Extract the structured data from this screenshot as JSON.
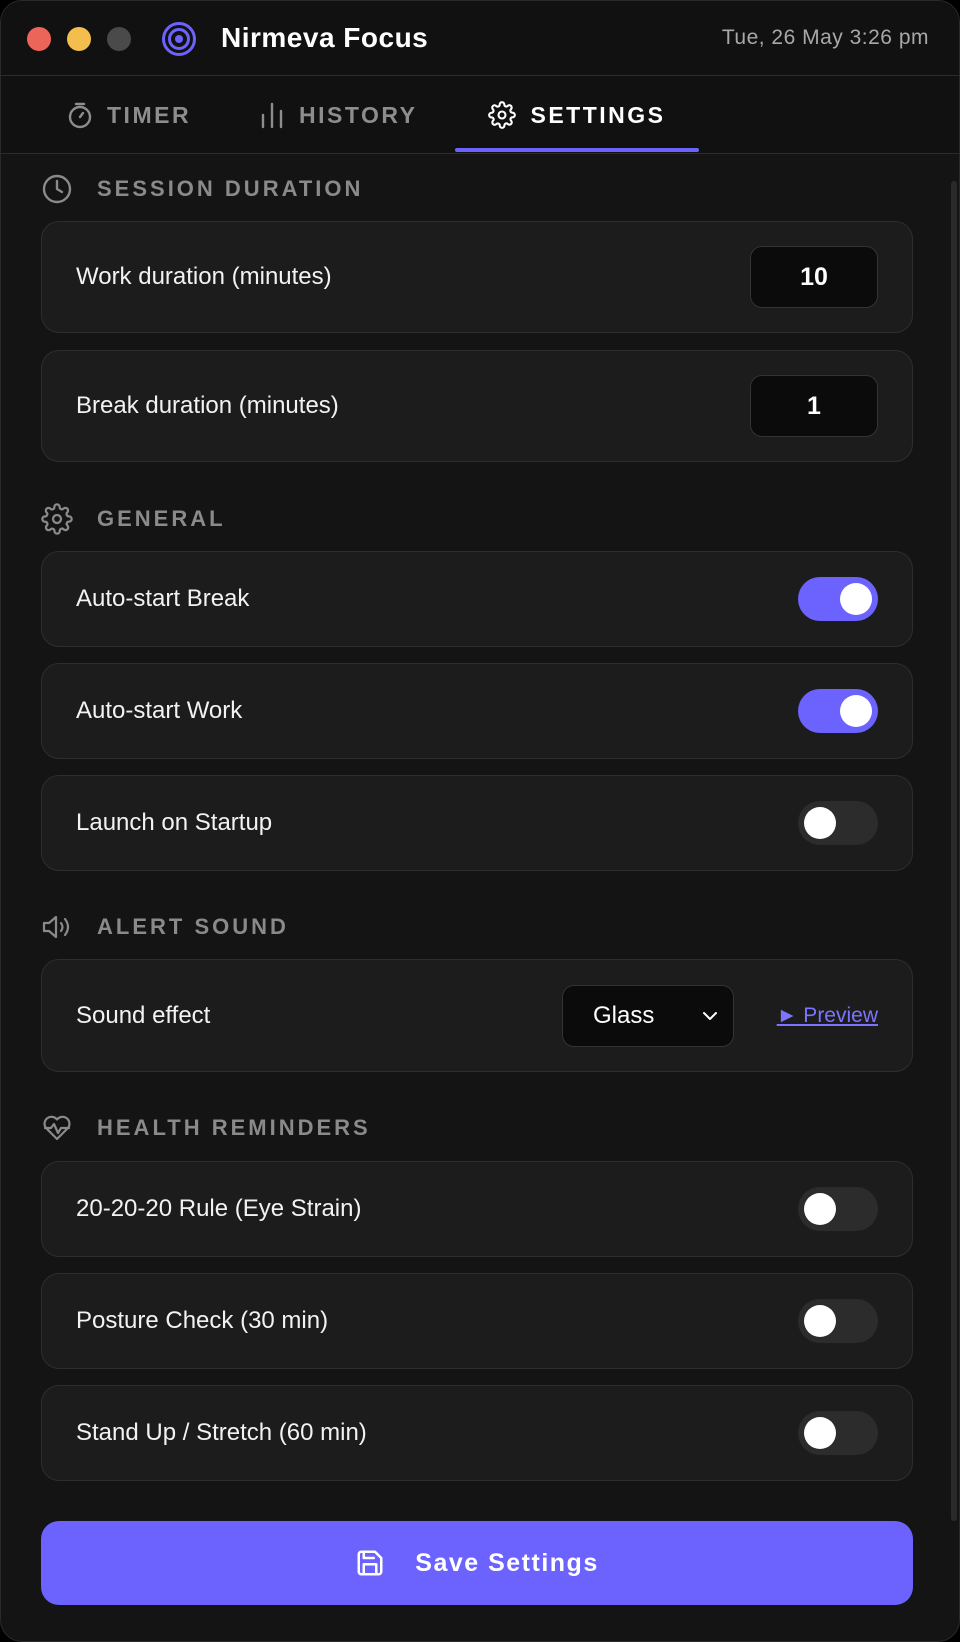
{
  "app": {
    "title": "Nirmeva Focus",
    "datetime": "Tue, 26 May 3:26 pm",
    "accent_color": "#6c63ff",
    "logo_icon": "target-icon"
  },
  "tabs": [
    {
      "label": "TIMER",
      "icon": "stopwatch-icon",
      "active": false
    },
    {
      "label": "HISTORY",
      "icon": "bar-chart-icon",
      "active": false
    },
    {
      "label": "SETTINGS",
      "icon": "gear-icon",
      "active": true
    }
  ],
  "sections": {
    "session": {
      "title": "SESSION DURATION",
      "icon": "clock-icon",
      "work_label": "Work duration (minutes)",
      "work_value": "10",
      "break_label": "Break duration (minutes)",
      "break_value": "1"
    },
    "general": {
      "title": "GENERAL",
      "icon": "gear-icon",
      "items": [
        {
          "label": "Auto-start Break",
          "enabled": true
        },
        {
          "label": "Auto-start Work",
          "enabled": true
        },
        {
          "label": "Launch on Startup",
          "enabled": false
        }
      ]
    },
    "alert": {
      "title": "ALERT SOUND",
      "icon": "speaker-icon",
      "sound_label": "Sound effect",
      "sound_value": "Glass",
      "preview_label": "► Preview"
    },
    "health": {
      "title": "HEALTH REMINDERS",
      "icon": "heart-pulse-icon",
      "items": [
        {
          "label": "20-20-20 Rule (Eye Strain)",
          "enabled": false
        },
        {
          "label": "Posture Check (30 min)",
          "enabled": false
        },
        {
          "label": "Stand Up / Stretch (60 min)",
          "enabled": false
        }
      ]
    }
  },
  "save": {
    "label": "Save Settings",
    "icon": "save-icon"
  }
}
